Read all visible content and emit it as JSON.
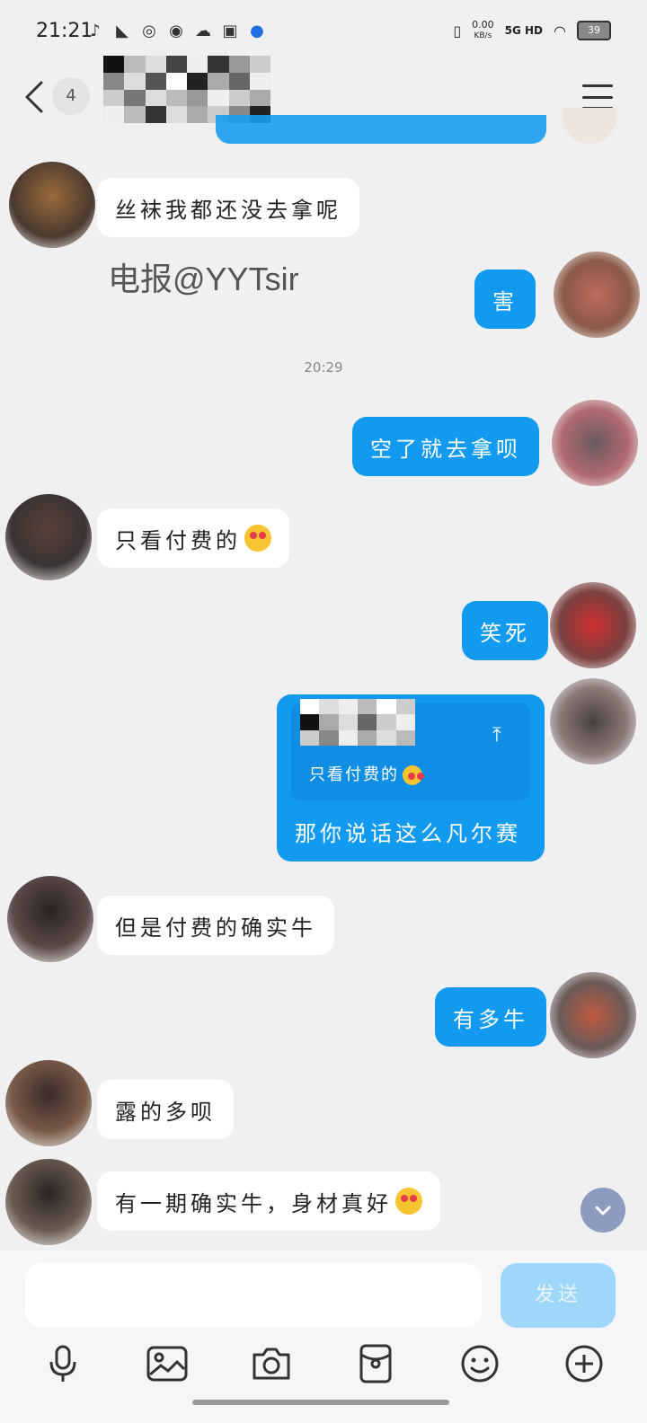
{
  "status_bar": {
    "time": "21:21",
    "net_speed": "0.00",
    "net_unit": "KB/s",
    "signal": "5G HD",
    "battery": "39"
  },
  "header": {
    "unread_count": "4"
  },
  "watermark": "电报@YYTsir",
  "time_separator": "20:29",
  "messages": [
    {
      "side": "in",
      "text": "丝袜我都还没去拿呢"
    },
    {
      "side": "out",
      "text": "害"
    },
    {
      "side": "out",
      "text": "空了就去拿呗"
    },
    {
      "side": "in",
      "text": "只看付费的"
    },
    {
      "side": "out",
      "text": "笑死"
    },
    {
      "side": "out",
      "quote": "只看付费的",
      "text": "那你说话这么凡尔赛"
    },
    {
      "side": "in",
      "text": "但是付费的确实牛"
    },
    {
      "side": "out",
      "text": "有多牛"
    },
    {
      "side": "in",
      "text": "露的多呗"
    },
    {
      "side": "in",
      "text": "有一期确实牛，身材真好"
    }
  ],
  "composer": {
    "send_label": "发送"
  },
  "toolbar": [
    "microphone-icon",
    "image-icon",
    "camera-icon",
    "red-packet-icon",
    "emoji-icon",
    "plus-icon"
  ]
}
